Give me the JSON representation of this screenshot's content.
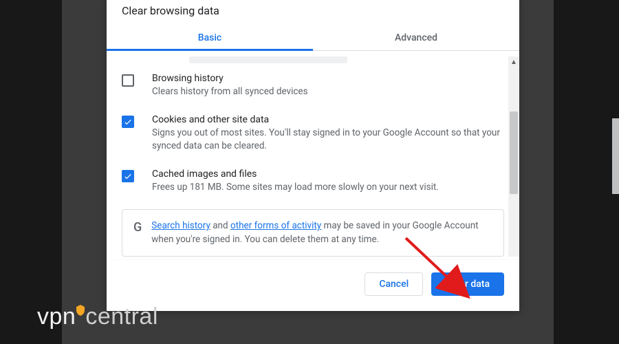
{
  "dialog": {
    "title": "Clear browsing data",
    "tabs": {
      "basic": "Basic",
      "advanced": "Advanced"
    },
    "options": {
      "history": {
        "checked": false,
        "title": "Browsing history",
        "desc": "Clears history from all synced devices"
      },
      "cookies": {
        "checked": true,
        "title": "Cookies and other site data",
        "desc": "Signs you out of most sites. You'll stay signed in to your Google Account so that your synced data can be cleared."
      },
      "cache": {
        "checked": true,
        "title": "Cached images and files",
        "desc": "Frees up 181 MB. Some sites may load more slowly on your next visit."
      }
    },
    "info": {
      "logo": "G",
      "link1": "Search history",
      "mid1": " and ",
      "link2": "other forms of activity",
      "tail": " may be saved in your Google Account when you're signed in. You can delete them at any time."
    },
    "buttons": {
      "cancel": "Cancel",
      "clear": "Clear data"
    }
  },
  "watermark": {
    "left": "vpn",
    "right": "central"
  },
  "colors": {
    "accent": "#1a73e8",
    "arrow": "#e11b1b"
  }
}
